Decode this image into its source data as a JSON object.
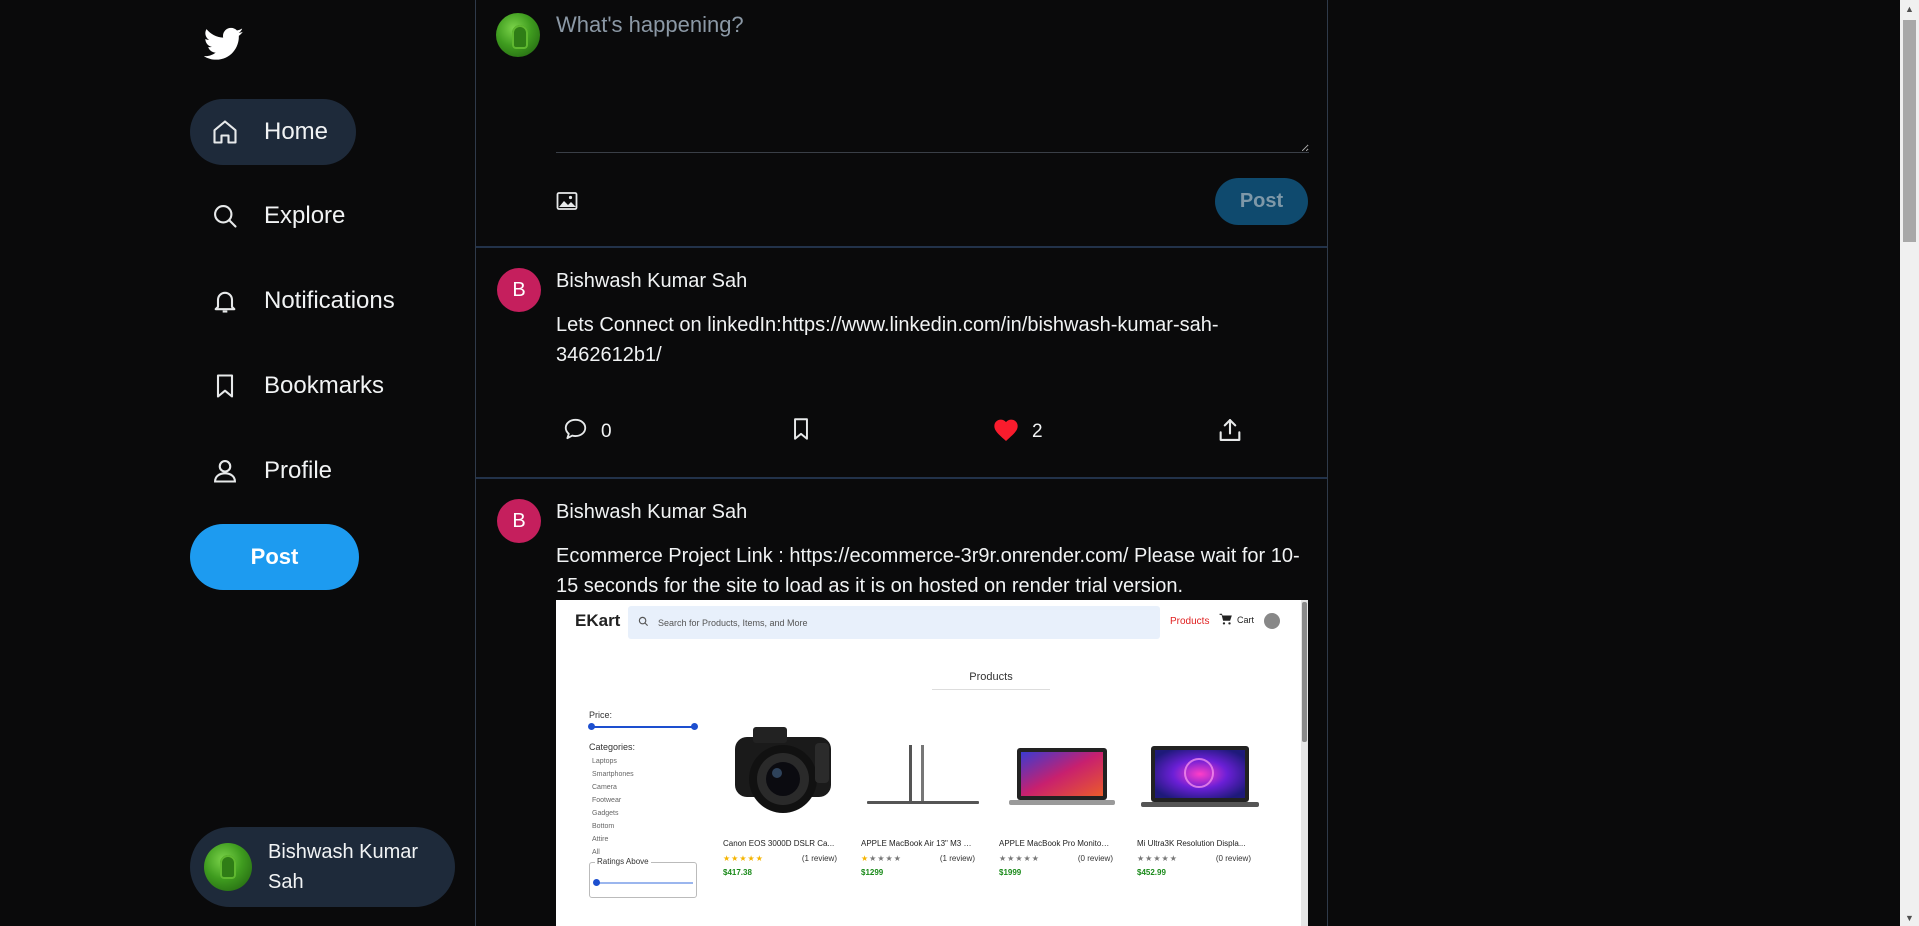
{
  "sidebar": {
    "nav": [
      {
        "label": "Home",
        "icon": "home-icon",
        "active": true
      },
      {
        "label": "Explore",
        "icon": "search-icon",
        "active": false
      },
      {
        "label": "Notifications",
        "icon": "bell-icon",
        "active": false
      },
      {
        "label": "Bookmarks",
        "icon": "bookmark-icon",
        "active": false
      },
      {
        "label": "Profile",
        "icon": "profile-icon",
        "active": false
      }
    ],
    "post_label": "Post",
    "user_name": "Bishwash Kumar Sah"
  },
  "composer": {
    "placeholder": "What's happening?",
    "post_label": "Post"
  },
  "tweets": [
    {
      "avatar_letter": "B",
      "author": "Bishwash Kumar Sah",
      "text": "Lets Connect on linkedIn:https://www.linkedin.com/in/bishwash-kumar-sah-3462612b1/",
      "comments": "0",
      "likes": "2"
    },
    {
      "avatar_letter": "B",
      "author": "Bishwash Kumar Sah",
      "text": "Ecommerce Project Link : https://ecommerce-3r9r.onrender.com/ Please wait for 10-15 seconds for the site to load as it is on hosted on render trial version.",
      "image": {
        "logo": "EKart",
        "search_placeholder": "Search for Products, Items, and More",
        "nav_products": "Products",
        "nav_cart": "Cart",
        "heading": "Products",
        "filters": {
          "price_label": "Price:",
          "categories_label": "Categories:",
          "categories": [
            "Laptops",
            "Smartphones",
            "Camera",
            "Footwear",
            "Gadgets",
            "Bottom",
            "Attire",
            "All"
          ],
          "ratings_label": "Ratings Above"
        },
        "products": [
          {
            "title": "Canon EOS 3000D DSLR Ca...",
            "rating": 5,
            "reviews": "(1 review)",
            "price": "$417.38"
          },
          {
            "title": "APPLE MacBook Air 13\" M3 M...",
            "rating": 1,
            "reviews": "(1 review)",
            "price": "$1299"
          },
          {
            "title": "APPLE MacBook Pro Monitor ...",
            "rating": 0,
            "reviews": "(0 review)",
            "price": "$1999"
          },
          {
            "title": "Mi Ultra3K Resolution Displa...",
            "rating": 0,
            "reviews": "(0 review)",
            "price": "$452.99"
          }
        ]
      }
    }
  ],
  "colors": {
    "accent": "#1d9bf0",
    "background": "#0a0a0b",
    "nav_active_bg": "#1e2a3a",
    "avatar_pink": "#c51f5d",
    "like_red": "#f91c2d"
  }
}
